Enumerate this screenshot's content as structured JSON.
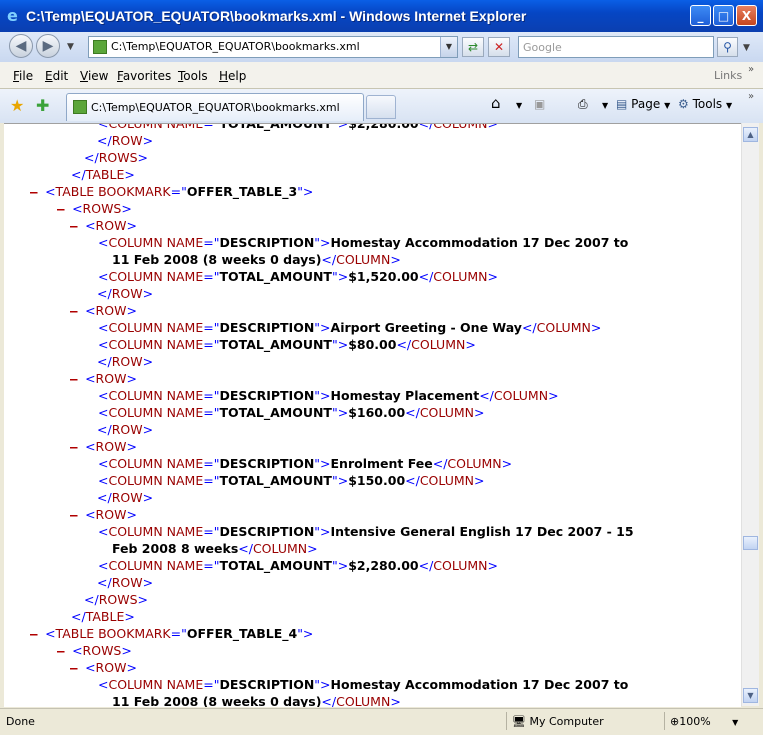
{
  "window": {
    "title": "C:\\Temp\\EQUATOR_EQUATOR\\bookmarks.xml - Windows Internet Explorer",
    "controls": {
      "minimize": "_",
      "maximize": "□",
      "close": "X"
    }
  },
  "address": {
    "url": "C:\\Temp\\EQUATOR_EQUATOR\\bookmarks.xml"
  },
  "search": {
    "placeholder": "Google"
  },
  "menu": {
    "items": [
      {
        "key": "F",
        "rest": "ile"
      },
      {
        "key": "E",
        "rest": "dit"
      },
      {
        "key": "V",
        "rest": "iew"
      },
      {
        "key": "F",
        "pre": "",
        "label": "Favorites",
        "rest": "avorites"
      },
      {
        "key": "T",
        "rest": "ools"
      },
      {
        "key": "H",
        "rest": "elp"
      }
    ],
    "links": "Links"
  },
  "tab": {
    "title": "C:\\Temp\\EQUATOR_EQUATOR\\bookmarks.xml"
  },
  "toolbar": {
    "page": "Page",
    "tools": "Tools"
  },
  "status": {
    "left": "Done",
    "zone": "My Computer",
    "zoom": "100%"
  },
  "xml": {
    "lines": [
      {
        "indent": 3,
        "type": "column",
        "name": "TOTAL_AMOUNT",
        "value": "$2,280.00",
        "partial": true
      },
      {
        "indent": 2,
        "type": "close",
        "tag": "ROW"
      },
      {
        "indent": 1,
        "type": "close",
        "tag": "ROWS"
      },
      {
        "indent": 0,
        "type": "close",
        "tag": "TABLE"
      },
      {
        "indent": -1,
        "type": "table",
        "bookmark": "OFFER_TABLE_3"
      },
      {
        "indent": 0,
        "type": "open",
        "tag": "ROWS"
      },
      {
        "indent": 1,
        "type": "open",
        "tag": "ROW"
      },
      {
        "indent": 3,
        "type": "column",
        "name": "DESCRIPTION",
        "value": "Homestay Accommodation 17 Dec 2007 to",
        "noclose": true
      },
      {
        "indent": 4,
        "type": "cont",
        "value": "11 Feb 2008 (8 weeks 0 days)"
      },
      {
        "indent": 3,
        "type": "column",
        "name": "TOTAL_AMOUNT",
        "value": "$1,520.00"
      },
      {
        "indent": 2,
        "type": "close",
        "tag": "ROW"
      },
      {
        "indent": 1,
        "type": "open",
        "tag": "ROW"
      },
      {
        "indent": 3,
        "type": "column",
        "name": "DESCRIPTION",
        "value": "Airport Greeting - One Way"
      },
      {
        "indent": 3,
        "type": "column",
        "name": "TOTAL_AMOUNT",
        "value": "$80.00"
      },
      {
        "indent": 2,
        "type": "close",
        "tag": "ROW"
      },
      {
        "indent": 1,
        "type": "open",
        "tag": "ROW"
      },
      {
        "indent": 3,
        "type": "column",
        "name": "DESCRIPTION",
        "value": "Homestay Placement"
      },
      {
        "indent": 3,
        "type": "column",
        "name": "TOTAL_AMOUNT",
        "value": "$160.00"
      },
      {
        "indent": 2,
        "type": "close",
        "tag": "ROW"
      },
      {
        "indent": 1,
        "type": "open",
        "tag": "ROW"
      },
      {
        "indent": 3,
        "type": "column",
        "name": "DESCRIPTION",
        "value": "Enrolment Fee"
      },
      {
        "indent": 3,
        "type": "column",
        "name": "TOTAL_AMOUNT",
        "value": "$150.00"
      },
      {
        "indent": 2,
        "type": "close",
        "tag": "ROW"
      },
      {
        "indent": 1,
        "type": "open",
        "tag": "ROW"
      },
      {
        "indent": 3,
        "type": "column",
        "name": "DESCRIPTION",
        "value": "Intensive General English 17 Dec 2007 - 15",
        "noclose": true
      },
      {
        "indent": 4,
        "type": "cont",
        "value": "Feb 2008 8 weeks"
      },
      {
        "indent": 3,
        "type": "column",
        "name": "TOTAL_AMOUNT",
        "value": "$2,280.00"
      },
      {
        "indent": 2,
        "type": "close",
        "tag": "ROW"
      },
      {
        "indent": 1,
        "type": "close",
        "tag": "ROWS"
      },
      {
        "indent": 0,
        "type": "close",
        "tag": "TABLE"
      },
      {
        "indent": -1,
        "type": "table",
        "bookmark": "OFFER_TABLE_4"
      },
      {
        "indent": 0,
        "type": "open",
        "tag": "ROWS"
      },
      {
        "indent": 1,
        "type": "open",
        "tag": "ROW"
      },
      {
        "indent": 3,
        "type": "column",
        "name": "DESCRIPTION",
        "value": "Homestay Accommodation 17 Dec 2007 to",
        "noclose": true
      },
      {
        "indent": 4,
        "type": "cont",
        "value": "11 Feb 2008 (8 weeks 0 days)"
      }
    ]
  }
}
